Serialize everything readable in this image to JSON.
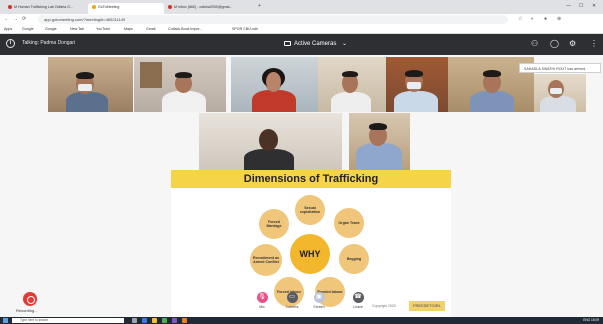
{
  "browser": {
    "tabs": [
      {
        "label": "M  Human Trafficking Lab Odisha G...",
        "dot": "#d93025"
      },
      {
        "label": "GoToMeeting",
        "dot": "#f4a700"
      },
      {
        "label": "M  Inbox (860) - odisha2000@gmai...",
        "dot": "#d93025"
      }
    ],
    "new_tab": "+",
    "url": "app.gotomeeting.com/?meetingId=465211149",
    "bookmarks": [
      "Apps",
      "Google",
      "Google",
      "New Tab",
      "YouTube",
      "Maps",
      "Gmail",
      "Cuttack Book Impor...",
      "SPOR CBU-nde"
    ],
    "window_controls": [
      "—",
      "☐",
      "✕"
    ],
    "right_icons": [
      "☆",
      "◐",
      "●",
      "⊕"
    ]
  },
  "meeting": {
    "speaker_label": "Talking: Padma Dongari",
    "view_label": "Active Cameras",
    "view_caret": "⌄",
    "toast": "SAHADLA SWATHI ROUT has arrived."
  },
  "slide": {
    "title": "Dimensions of Trafficking",
    "center": "WHY",
    "nodes": [
      "Sexual exploitation",
      "Organ Trade",
      "Begging",
      "Bonded labour",
      "Forced labour",
      "Recruitment as Armed Conflict",
      "Forced Marriage"
    ],
    "foot": "Copyright 2020",
    "brand": "FREESETGIRL"
  },
  "controls": {
    "mic": "Mic",
    "camera": "Camera",
    "screen": "Screen",
    "leave": "Leave",
    "recording": "Recording..."
  },
  "taskbar": {
    "search_placeholder": "Type here to search",
    "clock": "ENG  15:09"
  },
  "colors": {
    "accent_yellow": "#f5d547",
    "mic_pink": "#e8548a",
    "record_red": "#e53935",
    "topbar": "#2d2f33"
  }
}
